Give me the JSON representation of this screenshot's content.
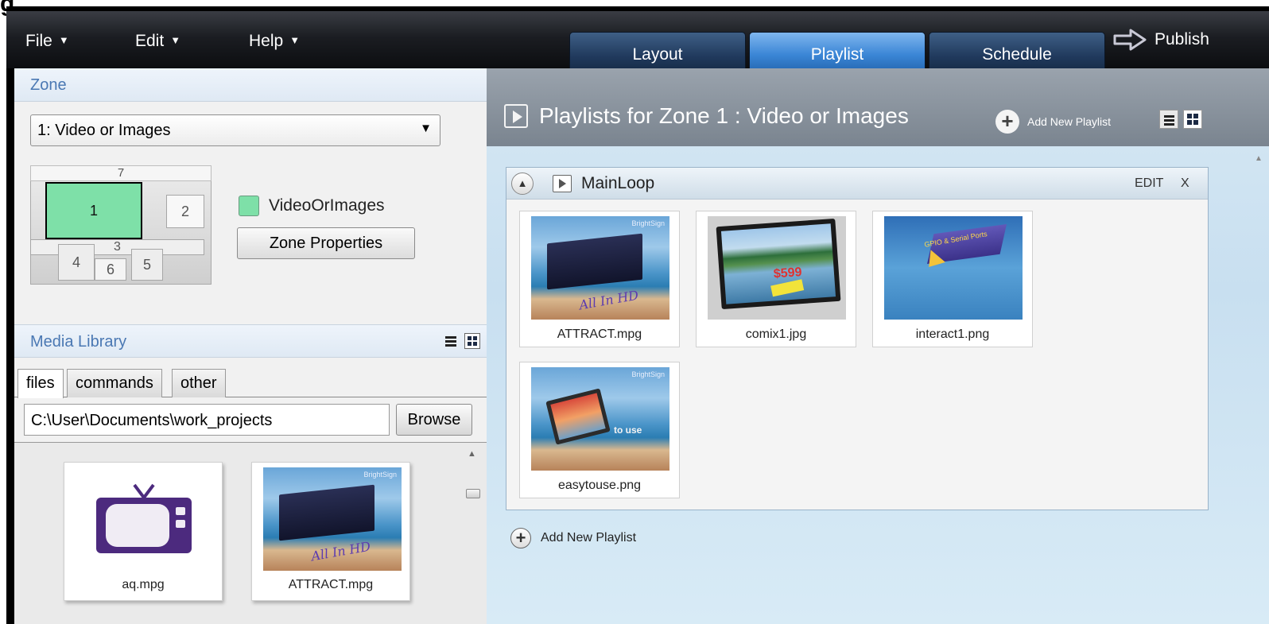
{
  "partial_top_char": "g",
  "menu": {
    "file": "File",
    "edit": "Edit",
    "help": "Help",
    "caret": "▼"
  },
  "tabs": [
    {
      "label": "Layout",
      "active": false
    },
    {
      "label": "Playlist",
      "active": true
    },
    {
      "label": "Schedule",
      "active": false
    }
  ],
  "publish_label": "Publish",
  "zone": {
    "header": "Zone",
    "selected": "1: Video or Images",
    "dropdown_arrow": "▼",
    "layout_numbers": [
      "1",
      "2",
      "3",
      "4",
      "5",
      "6",
      "7"
    ],
    "legend_label": "VideoOrImages",
    "legend_color": "#7ee0a8",
    "properties_button": "Zone Properties"
  },
  "media_library": {
    "header": "Media Library",
    "tabs": [
      "files",
      "commands",
      "other"
    ],
    "active_tab": "files",
    "path": "C:\\User\\Documents\\work_projects",
    "browse_label": "Browse",
    "items": [
      {
        "name": "aq.mpg",
        "icon": "tv-icon"
      },
      {
        "name": "ATTRACT.mpg",
        "icon": "video-thumbnail"
      }
    ]
  },
  "playlists_panel": {
    "title": "Playlists for Zone 1 : Video or Images",
    "add_new_label": "Add New Playlist",
    "playlist": {
      "name": "MainLoop",
      "edit_label": "EDIT",
      "close_label": "X",
      "items": [
        {
          "name": "ATTRACT.mpg"
        },
        {
          "name": "comix1.jpg"
        },
        {
          "name": "interact1.png"
        },
        {
          "name": "easytouse.png"
        }
      ]
    },
    "add_new_bottom_label": "Add New Playlist"
  },
  "thumb_text": {
    "brand": "BrightSign",
    "attract_script": "All In HD",
    "easy_to_use": "to use",
    "comix_price": "$599",
    "interact_sign": "GPIO & Serial Ports"
  },
  "accent_colors": {
    "active_tab": "#3b86d6",
    "header_text": "#4a78b3",
    "zone1": "#7ee0a8"
  }
}
